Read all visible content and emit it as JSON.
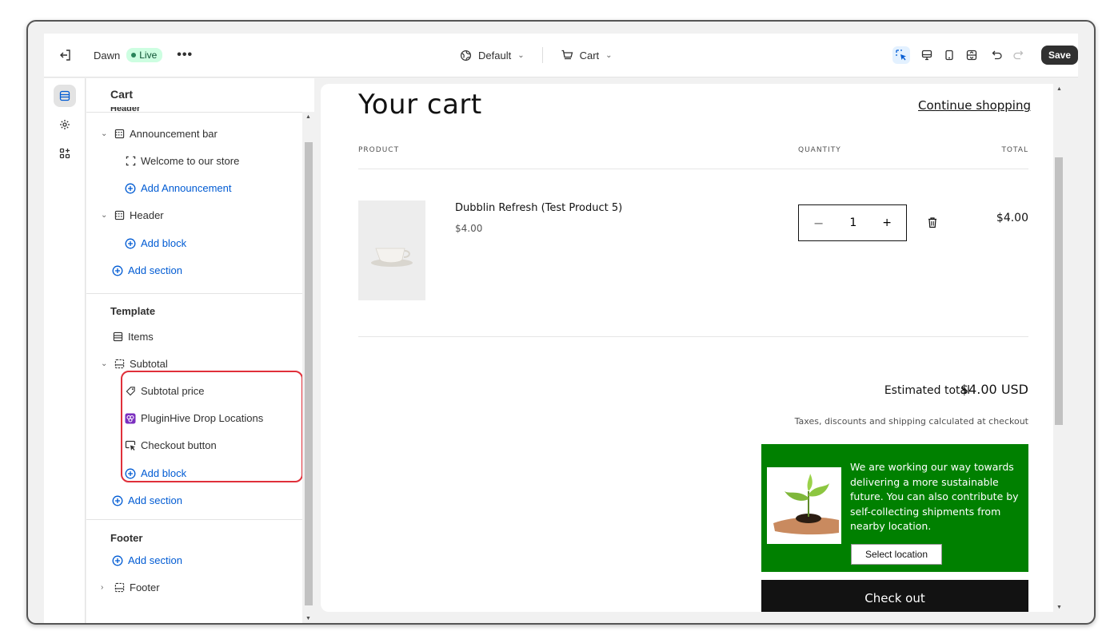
{
  "topbar": {
    "store_name": "Dawn",
    "live_label": "Live",
    "more_label": "•••",
    "theme_selector": "Default",
    "template_selector": "Cart",
    "save_label": "Save"
  },
  "panel": {
    "title": "Cart",
    "cutoff_heading": "Header",
    "header_group": [
      {
        "label": "Announcement bar",
        "icon": "section-icon",
        "expanded": true
      },
      {
        "label": "Welcome to our store",
        "icon": "block-icon"
      },
      {
        "label": "Add Announcement",
        "icon": "plus-circle-icon"
      },
      {
        "label": "Header",
        "icon": "section-icon",
        "expanded": true
      },
      {
        "label": "Add block",
        "icon": "plus-circle-icon"
      },
      {
        "label": "Add section",
        "icon": "plus-circle-icon"
      }
    ],
    "template_heading": "Template",
    "template_group": [
      {
        "label": "Items",
        "icon": "items-icon"
      },
      {
        "label": "Subtotal",
        "icon": "subtotal-icon",
        "expanded": true
      },
      {
        "label": "Subtotal price",
        "icon": "price-tag-icon"
      },
      {
        "label": "PluginHive Drop Locations",
        "icon": "app-icon"
      },
      {
        "label": "Checkout button",
        "icon": "cursor-button-icon"
      },
      {
        "label": "Add block",
        "icon": "plus-circle-icon"
      },
      {
        "label": "Add section",
        "icon": "plus-circle-icon"
      }
    ],
    "footer_heading": "Footer",
    "footer_group": [
      {
        "label": "Add section",
        "icon": "plus-circle-icon"
      },
      {
        "label": "Footer",
        "icon": "footer-icon",
        "expanded": false
      }
    ]
  },
  "preview": {
    "title": "Your cart",
    "continue_link": "Continue shopping",
    "columns": {
      "product": "PRODUCT",
      "quantity": "QUANTITY",
      "total": "TOTAL"
    },
    "item": {
      "name": "Dubblin Refresh (Test Product 5)",
      "price": "$4.00",
      "quantity": "1",
      "line_total": "$4.00"
    },
    "estimated_label": "Estimated total",
    "estimated_value": "$4.00 USD",
    "tax_note": "Taxes, discounts and shipping calculated at checkout",
    "promo_text": "We are working our way towards delivering a more sustainable future. You can also contribute by self-collecting shipments from nearby location.",
    "select_location_label": "Select location",
    "checkout_label": "Check out"
  },
  "colors": {
    "accent_blue": "#005bd3",
    "promo_green": "#008000",
    "highlight_red": "#e0303a"
  }
}
